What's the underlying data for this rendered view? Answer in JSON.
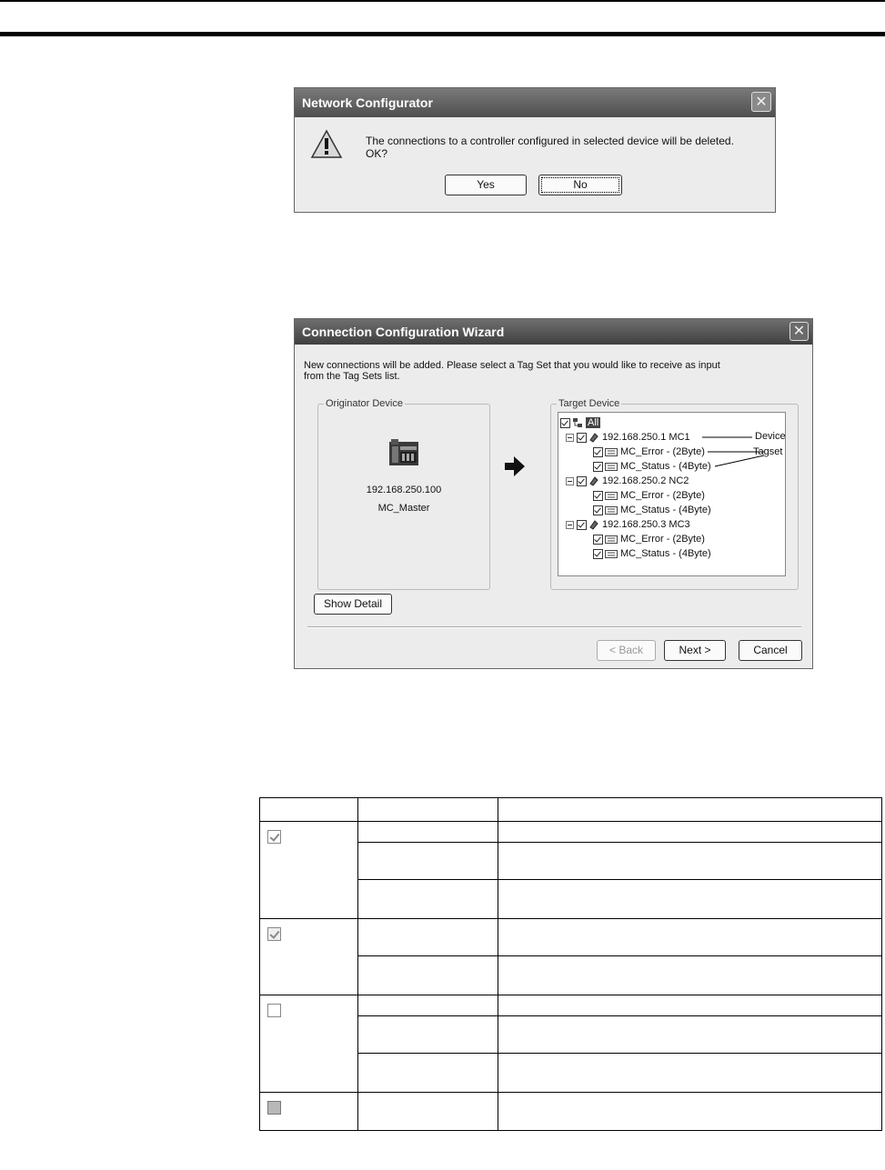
{
  "confirm_dialog": {
    "title": "Network Configurator",
    "message_line1": "The connections to a controller configured in selected device will be deleted.",
    "message_line2": "OK?",
    "yes_label": "Yes",
    "no_label": "No",
    "close_glyph": "✕",
    "icon": "warning-icon"
  },
  "wizard": {
    "title": "Connection Configuration Wizard",
    "close_glyph": "✕",
    "intro_line1": "New connections will be added. Please select a Tag Set that you would like to receive as input",
    "intro_line2": "from the Tag Sets list.",
    "originator": {
      "legend": "Originator Device",
      "ip": "192.168.250.100",
      "name": "MC_Master",
      "icon": "controller-icon"
    },
    "target": {
      "legend": "Target Device",
      "root_label": "All",
      "devices": [
        {
          "label": "192.168.250.1 MC1",
          "tagsets": [
            "MC_Error - (2Byte)",
            "MC_Status - (4Byte)"
          ]
        },
        {
          "label": "192.168.250.2 NC2",
          "tagsets": [
            "MC_Error - (2Byte)",
            "MC_Status - (4Byte)"
          ]
        },
        {
          "label": "192.168.250.3 MC3",
          "tagsets": [
            "MC_Error - (2Byte)",
            "MC_Status - (4Byte)"
          ]
        }
      ],
      "callouts": {
        "device": "Device",
        "tagset": "Tagset"
      }
    },
    "show_detail_label": "Show Detail",
    "back_label": "< Back",
    "next_label": "Next >",
    "cancel_label": "Cancel"
  },
  "table": {
    "groups": [
      {
        "checkbox": "checked-grey",
        "rows": 3
      },
      {
        "checkbox": "checked-dim",
        "rows": 2
      },
      {
        "checkbox": "unchecked",
        "rows": 3
      },
      {
        "checkbox": "grey-filled",
        "rows": 1
      }
    ]
  }
}
